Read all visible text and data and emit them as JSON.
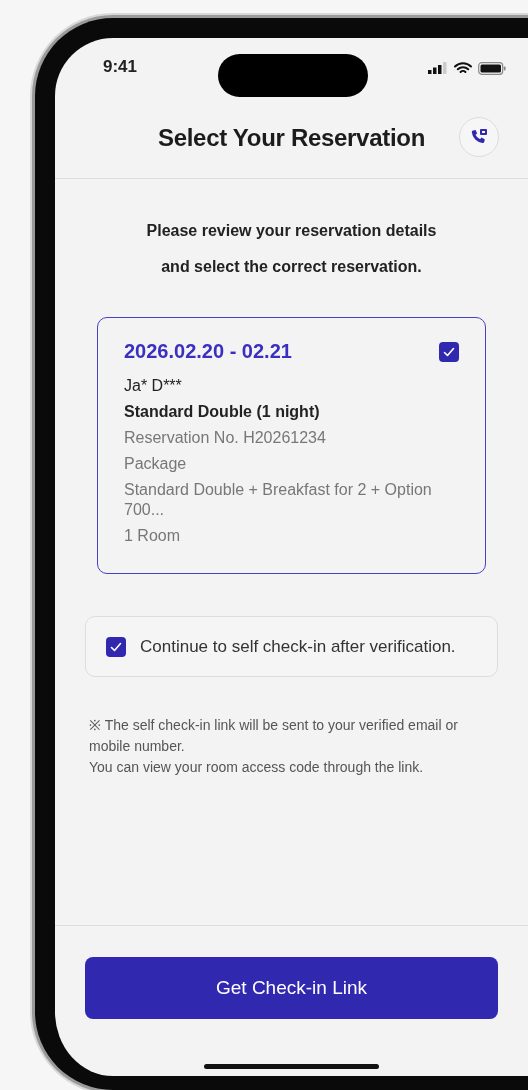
{
  "status_bar": {
    "time": "9:41"
  },
  "header": {
    "title": "Select Your Reservation"
  },
  "intro_lines": [
    "Please review your reservation details",
    "and select the correct reservation."
  ],
  "reservations": [
    {
      "dates": "2026.02.20 - 02.21",
      "selected": true,
      "guest": "Ja* D***",
      "room": "Standard Double (1 night)",
      "reservation_no": "Reservation No. H20261234",
      "package_label": "Package",
      "package": "Standard Double + Breakfast for 2 + Option 700...",
      "rooms": "1 Room"
    }
  ],
  "continue_option": {
    "label": "Continue to self check-in after verification.",
    "checked": true
  },
  "notes": [
    "※ The self check-in link will be sent to your verified email or mobile number.",
    "You can view your room access code through the link."
  ],
  "primary_button": "Get Check-in Link"
}
